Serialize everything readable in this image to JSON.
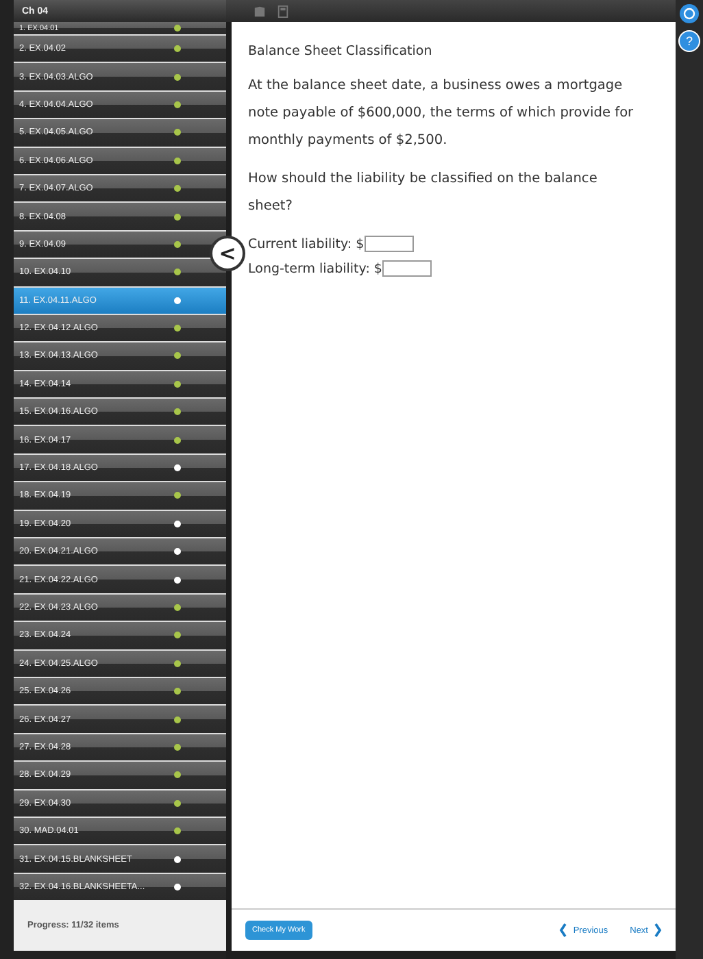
{
  "sidebar": {
    "title": "Ch 04",
    "items": [
      {
        "label": "1. EX.04.01",
        "done": true,
        "selected": false
      },
      {
        "label": "2. EX.04.02",
        "done": true,
        "selected": false
      },
      {
        "label": "3. EX.04.03.ALGO",
        "done": true,
        "selected": false
      },
      {
        "label": "4. EX.04.04.ALGO",
        "done": true,
        "selected": false
      },
      {
        "label": "5. EX.04.05.ALGO",
        "done": true,
        "selected": false
      },
      {
        "label": "6. EX.04.06.ALGO",
        "done": true,
        "selected": false
      },
      {
        "label": "7. EX.04.07.ALGO",
        "done": true,
        "selected": false
      },
      {
        "label": "8. EX.04.08",
        "done": true,
        "selected": false
      },
      {
        "label": "9. EX.04.09",
        "done": true,
        "selected": false
      },
      {
        "label": "10. EX.04.10",
        "done": true,
        "selected": false
      },
      {
        "label": "11. EX.04.11.ALGO",
        "done": false,
        "selected": true
      },
      {
        "label": "12. EX.04.12.ALGO",
        "done": true,
        "selected": false
      },
      {
        "label": "13. EX.04.13.ALGO",
        "done": true,
        "selected": false
      },
      {
        "label": "14. EX.04.14",
        "done": true,
        "selected": false
      },
      {
        "label": "15. EX.04.16.ALGO",
        "done": true,
        "selected": false
      },
      {
        "label": "16. EX.04.17",
        "done": true,
        "selected": false
      },
      {
        "label": "17. EX.04.18.ALGO",
        "done": false,
        "selected": false
      },
      {
        "label": "18. EX.04.19",
        "done": true,
        "selected": false
      },
      {
        "label": "19. EX.04.20",
        "done": false,
        "selected": false
      },
      {
        "label": "20. EX.04.21.ALGO",
        "done": false,
        "selected": false
      },
      {
        "label": "21. EX.04.22.ALGO",
        "done": false,
        "selected": false
      },
      {
        "label": "22. EX.04.23.ALGO",
        "done": true,
        "selected": false
      },
      {
        "label": "23. EX.04.24",
        "done": true,
        "selected": false
      },
      {
        "label": "24. EX.04.25.ALGO",
        "done": true,
        "selected": false
      },
      {
        "label": "25. EX.04.26",
        "done": true,
        "selected": false
      },
      {
        "label": "26. EX.04.27",
        "done": true,
        "selected": false
      },
      {
        "label": "27. EX.04.28",
        "done": true,
        "selected": false
      },
      {
        "label": "28. EX.04.29",
        "done": true,
        "selected": false
      },
      {
        "label": "29. EX.04.30",
        "done": true,
        "selected": false
      },
      {
        "label": "30. MAD.04.01",
        "done": true,
        "selected": false
      },
      {
        "label": "31. EX.04.15.BLANKSHEET",
        "done": false,
        "selected": false
      },
      {
        "label": "32. EX.04.16.BLANKSHEETA...",
        "done": false,
        "selected": false
      }
    ],
    "progress": "Progress:  11/32 items"
  },
  "question": {
    "title": "Balance Sheet Classification",
    "paragraphs": [
      "At the balance sheet date, a business owes a mortgage note payable of $600,000, the terms of which provide for monthly payments of $2,500.",
      "How should the liability be classified on the balance sheet?"
    ],
    "fields": [
      {
        "label": "Current liability: $"
      },
      {
        "label": "Long-term liability: $"
      }
    ]
  },
  "footer": {
    "check": "Check My Work",
    "previous": "Previous",
    "next": "Next"
  },
  "help": "?",
  "collapse": "<"
}
